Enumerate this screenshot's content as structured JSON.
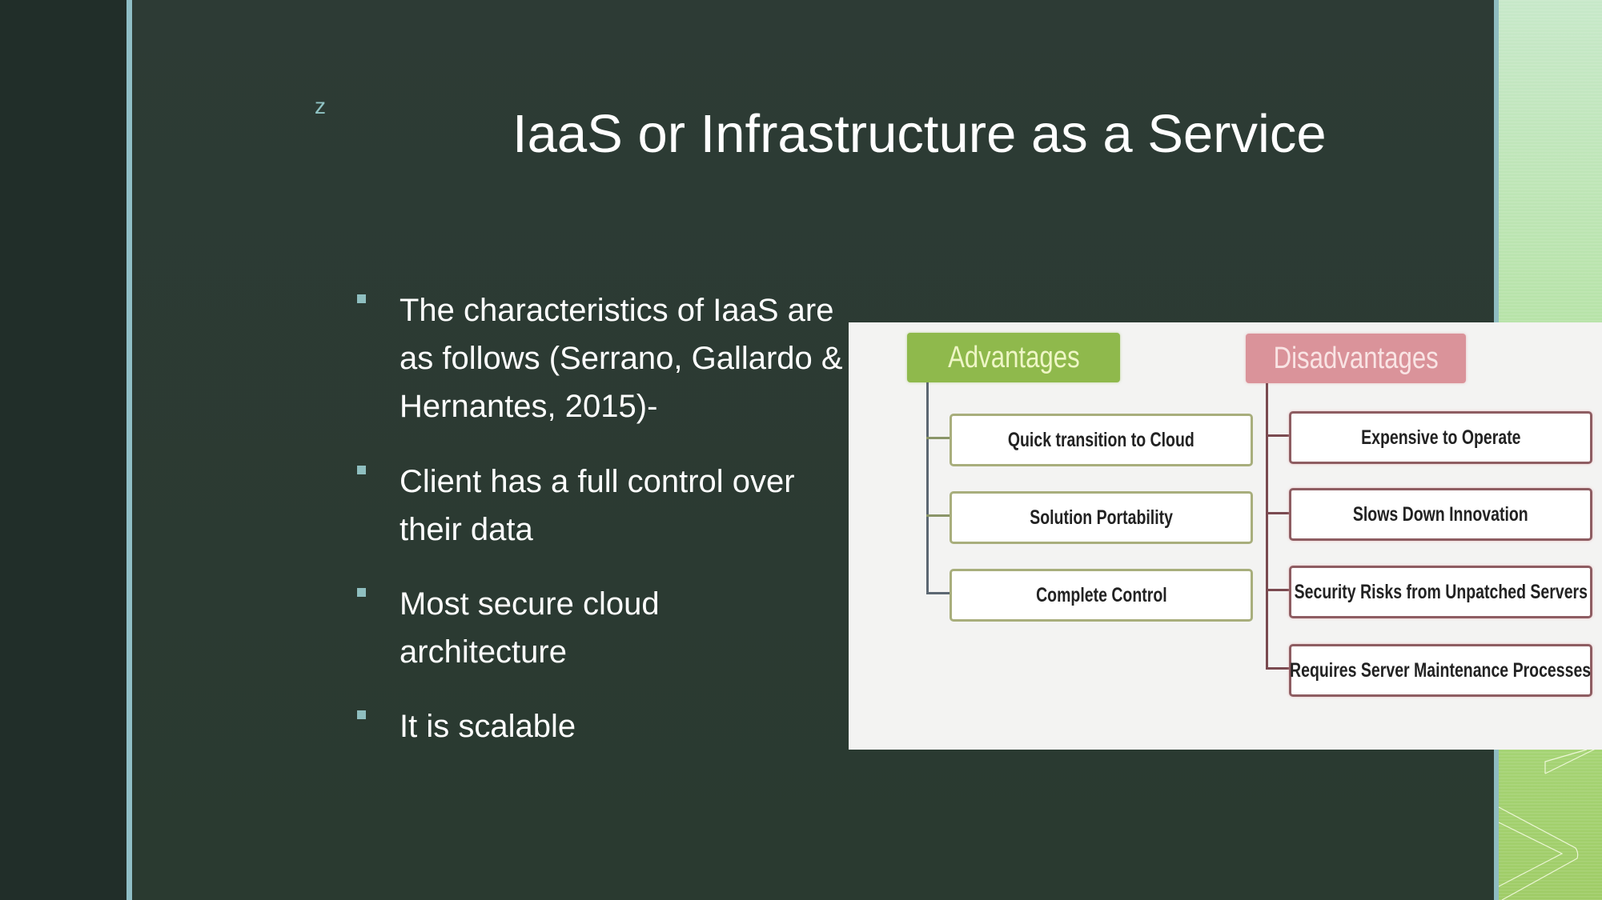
{
  "slide": {
    "marker": "z",
    "title": "IaaS or Infrastructure as a Service",
    "bullets": [
      {
        "text": "The characteristics of IaaS are as follows (Serrano, Gallardo & Hernantes, 2015)-"
      },
      {
        "text": "Client has a full control over their data"
      },
      {
        "text": "Most secure cloud architecture"
      },
      {
        "text": "It is scalable"
      }
    ]
  },
  "diagram": {
    "advantages": {
      "heading": "Advantages",
      "color": "#8fb94c",
      "items": [
        "Quick transition to Cloud",
        "Solution Portability",
        "Complete Control"
      ]
    },
    "disadvantages": {
      "heading": "Disadvantages",
      "color": "#da939a",
      "items": [
        "Expensive to Operate",
        "Slows Down Innovation",
        "Security Risks from Unpatched Servers",
        "Requires Server Maintenance Processes"
      ]
    }
  },
  "theme": {
    "background": "#2b3a32",
    "accent_line": "#8fbec6",
    "side_panel_green": "#a9d97e",
    "text": "#ffffff"
  }
}
